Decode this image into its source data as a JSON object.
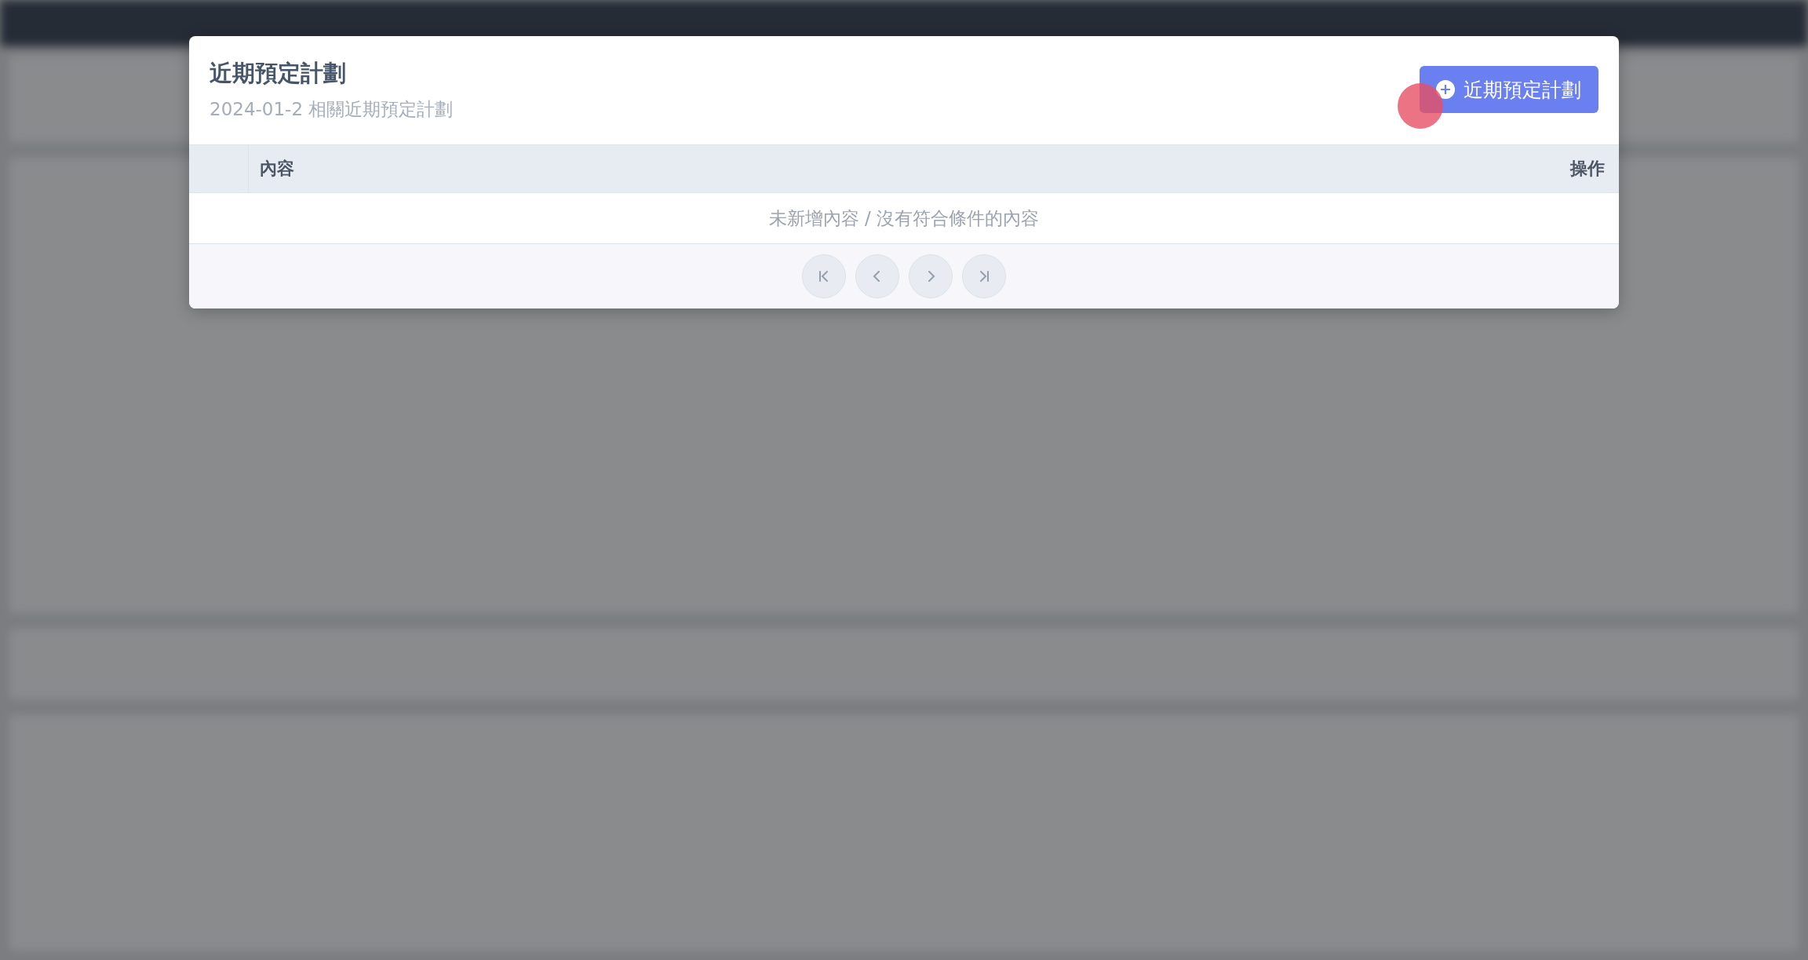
{
  "dialog": {
    "title": "近期預定計劃",
    "subtitle": "2024-01-2 相關近期預定計劃",
    "add_button": {
      "label": "近期預定計劃"
    },
    "table": {
      "columns": [
        "內容",
        "操作"
      ],
      "empty_message": "未新增內容 / 沒有符合條件的內容"
    },
    "pagination": [
      {
        "kind": "first",
        "disabled": true
      },
      {
        "kind": "prev",
        "disabled": true
      },
      {
        "kind": "next",
        "disabled": true
      },
      {
        "kind": "last",
        "disabled": true
      }
    ]
  }
}
